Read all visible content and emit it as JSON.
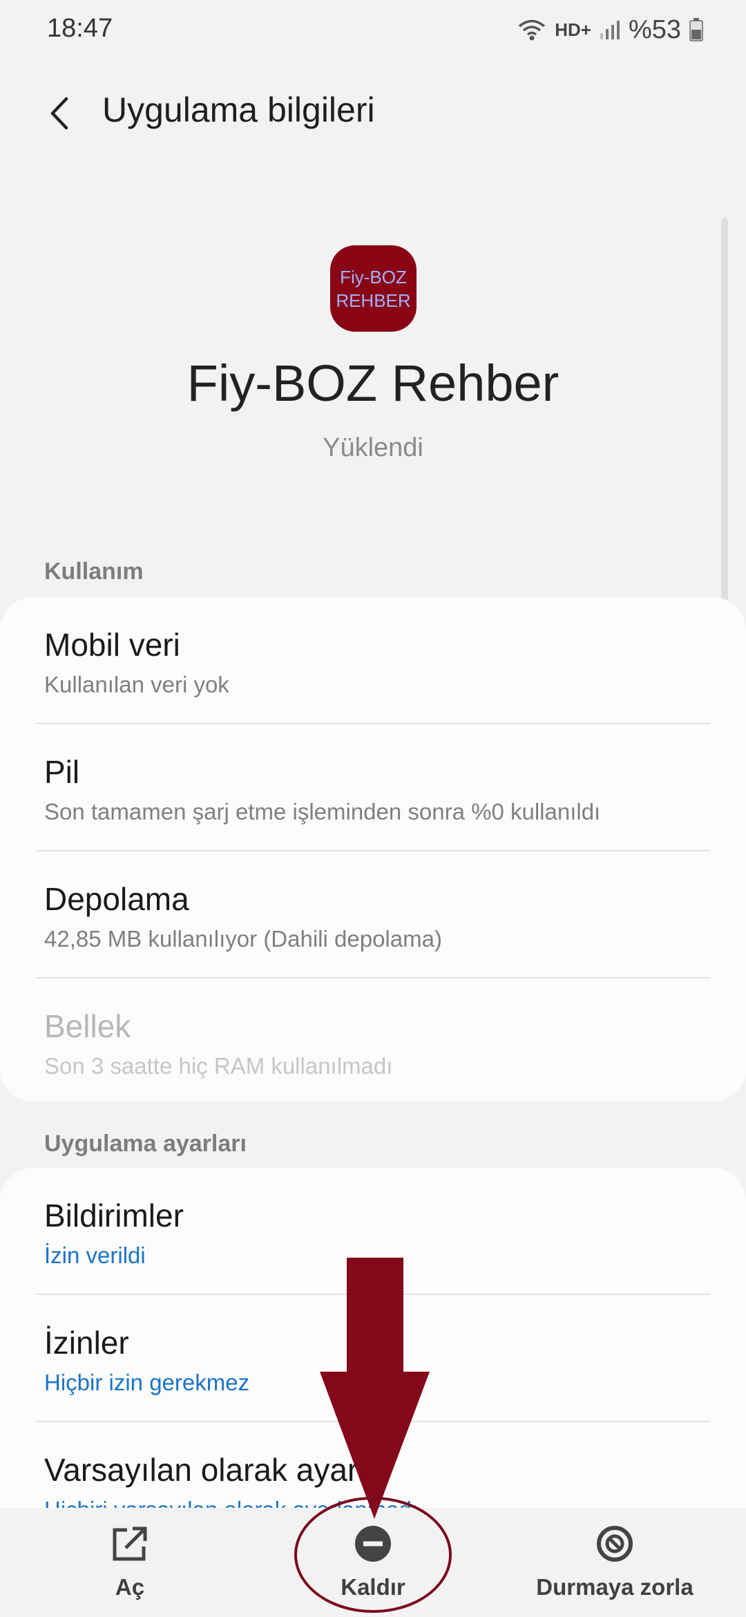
{
  "status_bar": {
    "time": "18:47",
    "network": "HD+",
    "battery": "%53"
  },
  "header": {
    "title": "Uygulama bilgileri"
  },
  "app": {
    "icon_line1": "Fiy-BOZ",
    "icon_line2": "REHBER",
    "icon_color": "#8a0514",
    "name": "Fiy-BOZ Rehber",
    "status": "Yüklendi"
  },
  "usage": {
    "title": "Kullanım",
    "items": [
      {
        "title": "Mobil veri",
        "subtitle": "Kullanılan veri yok"
      },
      {
        "title": "Pil",
        "subtitle": "Son tamamen şarj etme işleminden sonra %0 kullanıldı"
      },
      {
        "title": "Depolama",
        "subtitle": "42,85 MB kullanılıyor (Dahili depolama)"
      },
      {
        "title": "Bellek",
        "subtitle": "Son 3 saatte hiç RAM kullanılmadı"
      }
    ]
  },
  "app_settings": {
    "title": "Uygulama ayarları",
    "items": [
      {
        "title": "Bildirimler",
        "subtitle": "İzin verildi"
      },
      {
        "title": "İzinler",
        "subtitle": "Hiçbir izin gerekmez"
      },
      {
        "title": "Varsayılan olarak ayarla",
        "subtitle": "Hiçbiri varsayılan olarak ayarlanmadı"
      }
    ]
  },
  "actions": {
    "open": "Aç",
    "uninstall": "Kaldır",
    "force_stop": "Durmaya zorla"
  },
  "accent_color": "#1b74c8",
  "annotation_color": "#7a0a1c"
}
